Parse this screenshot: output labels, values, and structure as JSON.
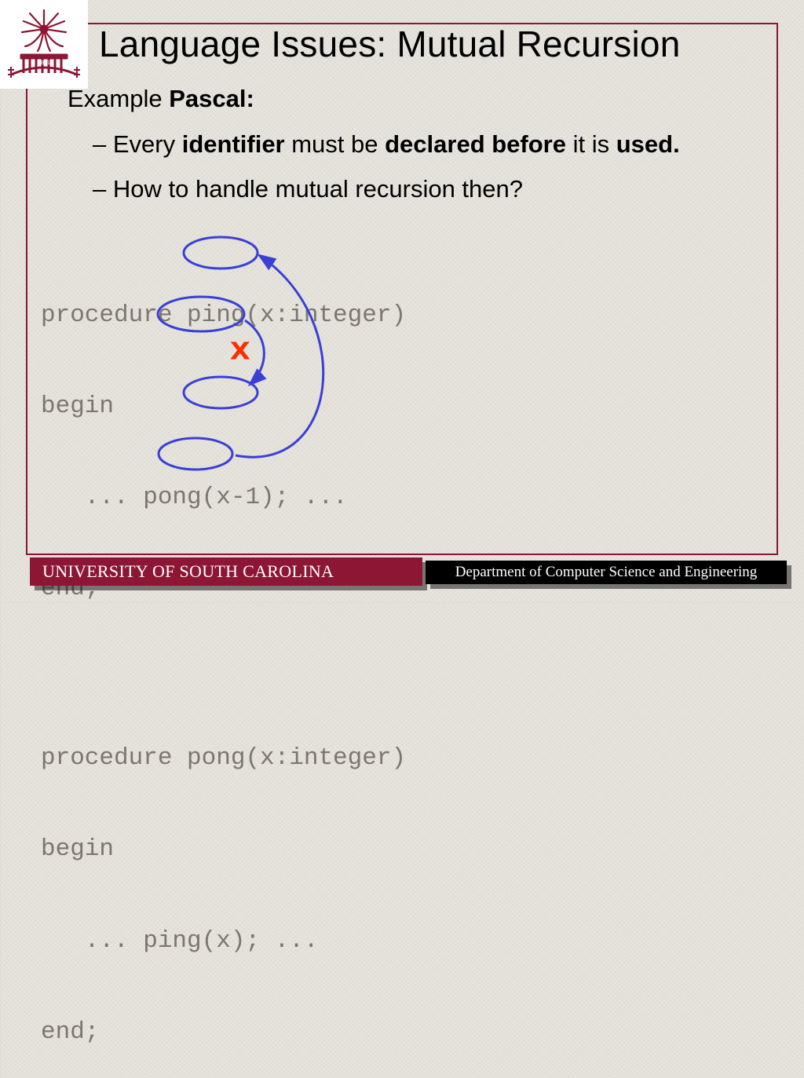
{
  "title": "Language Issues: Mutual Recursion",
  "example": {
    "prefix": "Example ",
    "lang": "Pascal:"
  },
  "bullets": {
    "b1": {
      "t1": "Every ",
      "t2": "identifier",
      "t3": " must be ",
      "t4": "declared before",
      "t5": " it is ",
      "t6": "used."
    },
    "b2": "How to handle mutual recursion then?"
  },
  "code": {
    "l1": "procedure ping(x:integer)",
    "l2": "begin",
    "l3": "   ... pong(x-1); ...",
    "l4": "end;",
    "l5": "procedure pong(x:integer)",
    "l6": "begin",
    "l7": "   ... ping(x); ...",
    "l8": "end;"
  },
  "xmark": "x",
  "footer": {
    "univ": "UNIVERSITY OF SOUTH CAROLINA",
    "dept": "Department of Computer Science and Engineering"
  },
  "colors": {
    "accent": "#8c1633",
    "arrow": "#3a3fd6"
  }
}
